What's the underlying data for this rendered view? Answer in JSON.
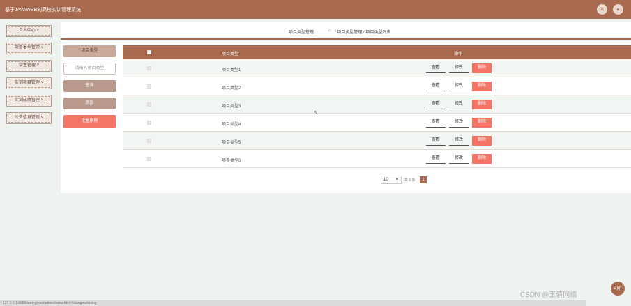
{
  "app": {
    "title": "基于JAVAWEB的高校实训管理系统"
  },
  "header": {
    "close_icon": "close-icon",
    "user_icon": "user-icon"
  },
  "sidebar": {
    "items": [
      {
        "label": "个人中心 ˅"
      },
      {
        "label": "项目类型管理 ˅"
      },
      {
        "label": "学生管理 ˅"
      },
      {
        "label": "实训项目管理 ˅"
      },
      {
        "label": "实训成绩管理 ˅"
      },
      {
        "label": "公告信息管理 ˅"
      }
    ]
  },
  "breadcrumb": {
    "section": "项目类型管理",
    "home_icon": "⌂",
    "path": "/ 项目类型管理 / 项目类型列表"
  },
  "left_panel": {
    "tab_label": "项目类型",
    "search_placeholder": "请输入项目类型",
    "query_label": "查询",
    "add_label": "添加",
    "batch_delete_label": "批量删除"
  },
  "table": {
    "headers": {
      "name": "项目类型",
      "ops": "操作"
    },
    "rows": [
      {
        "name": "项目类型1"
      },
      {
        "name": "项目类型2"
      },
      {
        "name": "项目类型3"
      },
      {
        "name": "项目类型4"
      },
      {
        "name": "项目类型5"
      },
      {
        "name": "项目类型6"
      }
    ],
    "ops": {
      "view": "查看",
      "edit": "修改",
      "delete": "删除"
    }
  },
  "pager": {
    "page_size": "10",
    "total": "共 6 条",
    "current_page": "1"
  },
  "statusbar": {
    "url": "127.0.0.1:8080/springboot/admin/index.html#/xiangmuleixing"
  },
  "float_button": {
    "label": "App"
  },
  "watermark": "CSDN @王倩网络",
  "colors": {
    "primary": "#a86a4e",
    "danger": "#f47466",
    "bg": "#eef3f0"
  }
}
